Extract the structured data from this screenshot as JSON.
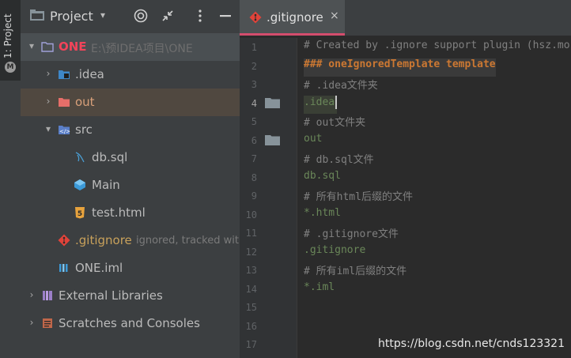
{
  "toolstrip": {
    "label": "1: Project"
  },
  "project_panel": {
    "title": "Project",
    "tree": [
      {
        "label": "ONE",
        "path": "E:\\预IDEA项目\\ONE"
      },
      {
        "label": ".idea"
      },
      {
        "label": "out"
      },
      {
        "label": "src"
      },
      {
        "label": "db.sql"
      },
      {
        "label": "Main"
      },
      {
        "label": "test.html"
      },
      {
        "label": ".gitignore",
        "status": "ignored, tracked wit"
      },
      {
        "label": "ONE.iml"
      },
      {
        "label": "External Libraries"
      },
      {
        "label": "Scratches and Consoles"
      }
    ]
  },
  "editor": {
    "tab_label": ".gitignore",
    "tab_close": "×",
    "line_numbers": [
      "1",
      "2",
      "3",
      "4",
      "5",
      "6",
      "7",
      "8",
      "9",
      "10",
      "11",
      "12",
      "13",
      "14",
      "15",
      "16",
      "17"
    ],
    "lines": [
      "# Created by .ignore support plugin (hsz.mo",
      "### oneIgnoredTemplate template",
      "# .idea文件夹",
      ".idea",
      "# out文件夹",
      "out",
      "# db.sql文件",
      "db.sql",
      "# 所有html后缀的文件",
      "*.html",
      "# .gitignore文件",
      ".gitignore",
      "# 所有iml后缀的文件",
      "*.iml",
      "",
      "",
      ""
    ]
  },
  "watermark": "https://blog.csdn.net/cnds123321",
  "colors": {
    "accent": "#d44d6d",
    "comment": "#808080",
    "keyword": "#cc7832",
    "string": "#6a8759"
  }
}
